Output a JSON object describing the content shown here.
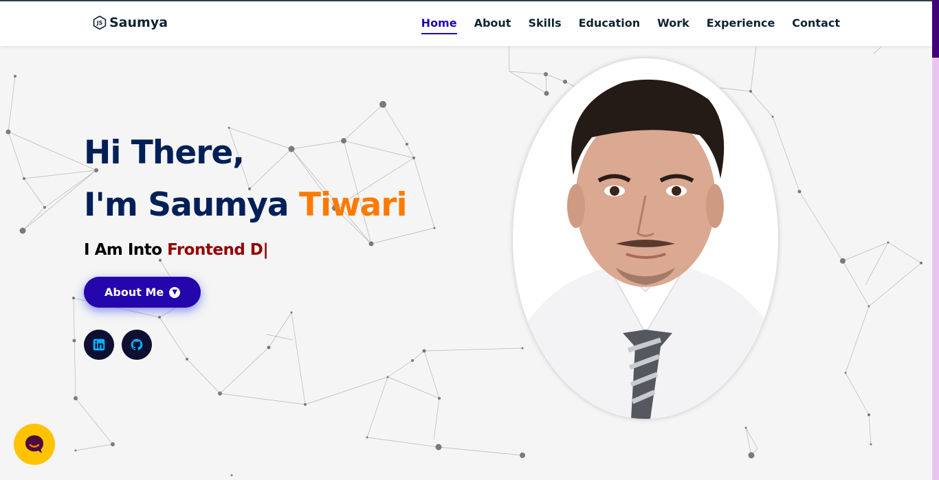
{
  "header": {
    "logo_text": "Saumya",
    "logo_icon": "nodejs-js-icon",
    "nav": [
      {
        "label": "Home",
        "active": true
      },
      {
        "label": "About"
      },
      {
        "label": "Skills"
      },
      {
        "label": "Education"
      },
      {
        "label": "Work"
      },
      {
        "label": "Experience"
      },
      {
        "label": "Contact"
      }
    ]
  },
  "hero": {
    "greeting": "Hi There,",
    "intro": "I'm Saumya",
    "name_accent": "Tiwari",
    "typed_prefix": "I Am Into",
    "typed_text": "Frontend D",
    "cursor": "|",
    "about_button": "About Me",
    "socials": [
      {
        "name": "linkedin-icon"
      },
      {
        "name": "github-icon"
      }
    ]
  },
  "colors": {
    "accent": "#ff7a00",
    "primary_button": "#2506ad",
    "heading": "#002057",
    "typed": "#920101",
    "chat": "#ffc300",
    "scroll_thumb": "#420177"
  },
  "chat_widget": {
    "icon": "chat-bubble-icon"
  }
}
